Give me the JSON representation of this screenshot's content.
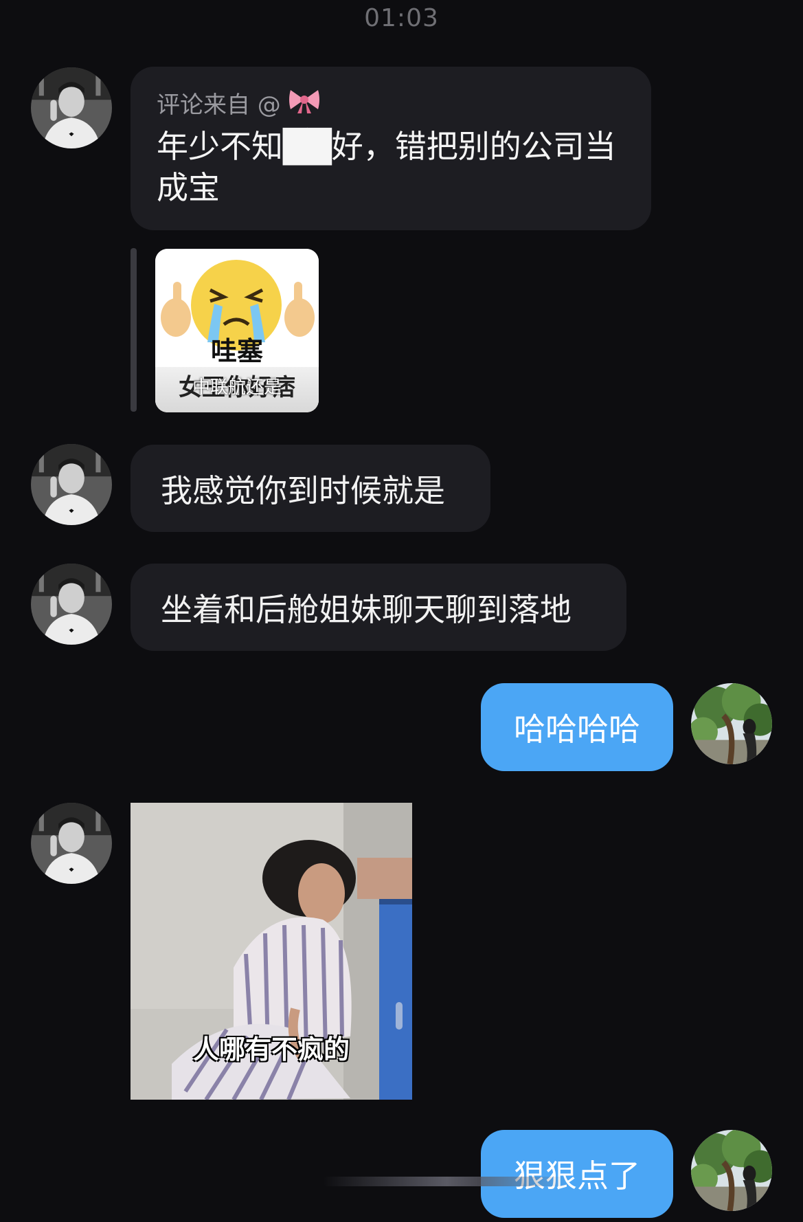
{
  "status": {
    "time": "01:03"
  },
  "icons": {
    "bow": "bow-emoji-icon",
    "avatar_contact": "contact-avatar",
    "avatar_self": "self-avatar"
  },
  "colors": {
    "background": "#0d0d10",
    "incoming_bubble": "#1d1d22",
    "outgoing_bubble": "#4ba6f5",
    "timestamp": "#6f6f74",
    "quote_source": "#9a9aa0"
  },
  "messages": {
    "quote": {
      "source_label": "评论来自 @",
      "text": "年少不知██好，错把别的公司当成宝"
    },
    "sticker": {
      "line1": "哇塞",
      "line2": "女王你好痞",
      "overlay": "中联航还是"
    },
    "msg1": "我感觉你到时候就是",
    "msg2": "坐着和后舱姐妹聊天聊到落地",
    "reply1": "哈哈哈哈",
    "meme_caption": "人哪有不疯的",
    "reply2": "狠狠点了"
  }
}
